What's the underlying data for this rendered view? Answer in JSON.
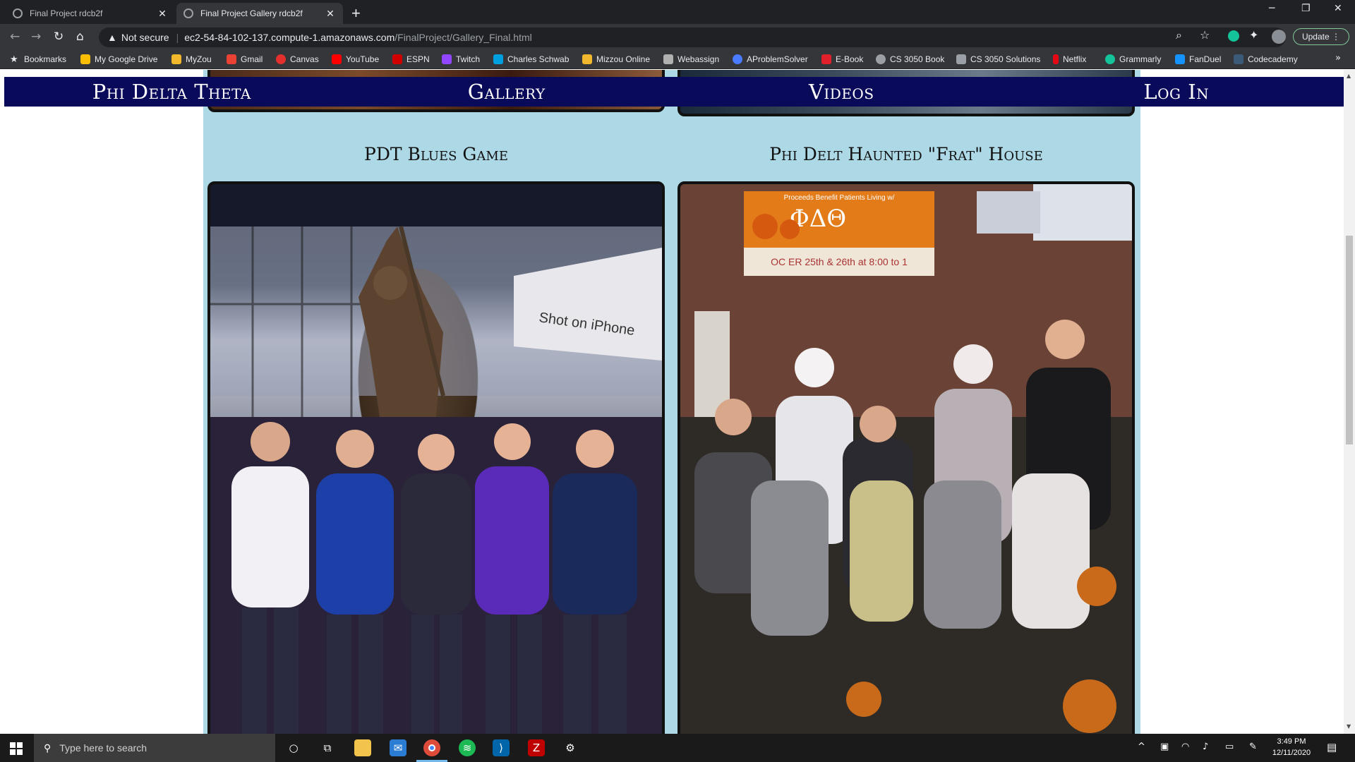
{
  "browser": {
    "tabs": [
      {
        "title": "Final Project rdcb2f",
        "active": false
      },
      {
        "title": "Final Project Gallery rdcb2f",
        "active": true
      }
    ],
    "omnibox": {
      "security_label": "Not secure",
      "host": "ec2-54-84-102-137.compute-1.amazonaws.com",
      "path": "/FinalProject/Gallery_Final.html"
    },
    "update_label": "Update",
    "bookmarks": [
      {
        "label": "Bookmarks",
        "icon": "star-icon",
        "color": "#e8eaed"
      },
      {
        "label": "My Google Drive",
        "icon": "google-drive-icon",
        "color": "#fbbc04"
      },
      {
        "label": "MyZou",
        "icon": "myzou-icon",
        "color": "#f1b82d"
      },
      {
        "label": "Gmail",
        "icon": "gmail-icon",
        "color": "#ea4335"
      },
      {
        "label": "Canvas",
        "icon": "canvas-icon",
        "color": "#e4302d"
      },
      {
        "label": "YouTube",
        "icon": "youtube-icon",
        "color": "#ff0000"
      },
      {
        "label": "ESPN",
        "icon": "espn-icon",
        "color": "#d00000"
      },
      {
        "label": "Twitch",
        "icon": "twitch-icon",
        "color": "#9146ff"
      },
      {
        "label": "Charles Schwab",
        "icon": "schwab-icon",
        "color": "#00a0df"
      },
      {
        "label": "Mizzou Online",
        "icon": "mizzou-icon",
        "color": "#f1b82d"
      },
      {
        "label": "Webassign",
        "icon": "webassign-icon",
        "color": "#b0b0b0"
      },
      {
        "label": "AProblemSolver",
        "icon": "aproblemsolver-icon",
        "color": "#4a7cff"
      },
      {
        "label": "E-Book",
        "icon": "ebook-icon",
        "color": "#e0202a"
      },
      {
        "label": "CS 3050 Book",
        "icon": "globe-icon",
        "color": "#9aa0a6"
      },
      {
        "label": "CS 3050 Solutions",
        "icon": "wiki-icon",
        "color": "#9aa0a6"
      },
      {
        "label": "Netflix",
        "icon": "netflix-icon",
        "color": "#e50914"
      },
      {
        "label": "Grammarly",
        "icon": "grammarly-icon",
        "color": "#15c39a"
      },
      {
        "label": "FanDuel",
        "icon": "fanduel-icon",
        "color": "#1493ff"
      },
      {
        "label": "Codecademy",
        "icon": "codecademy-icon",
        "color": "#3a5a78"
      }
    ]
  },
  "page": {
    "nav": [
      {
        "label": "Phi Delta Theta"
      },
      {
        "label": "Gallery"
      },
      {
        "label": "Videos"
      },
      {
        "label": "Log In"
      }
    ],
    "captions": {
      "left": "PDT Blues Game",
      "right": "Phi Delt Haunted \"Frat\" House"
    },
    "photo_text": {
      "shot_on": "Shot on iPhone",
      "banner_letters": "ΦΔΘ",
      "banner_dates": "OC  ER 25th & 26th at 8:00 to 1",
      "banner_top": "Proceeds Benefit Patients Living w/"
    },
    "colors": {
      "content_bg": "#add8e6",
      "nav_bg": "#0a0a5a"
    }
  },
  "taskbar": {
    "search_placeholder": "Type here to search",
    "time": "3:49 PM",
    "date": "12/11/2020"
  }
}
